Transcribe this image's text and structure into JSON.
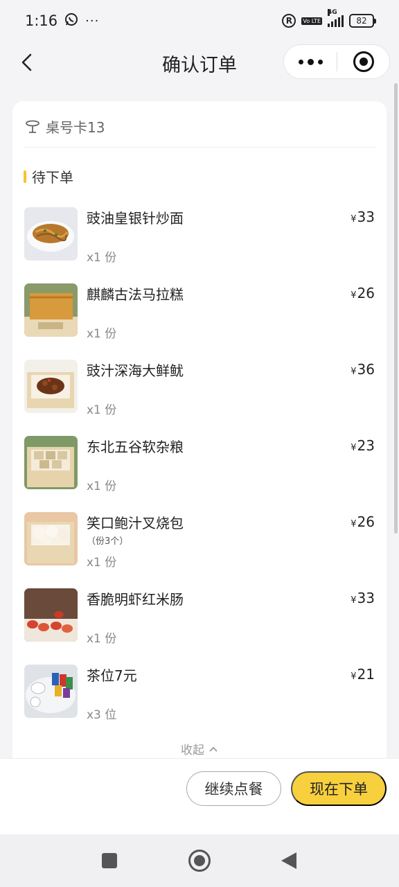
{
  "status": {
    "time": "1:16",
    "network": "4G",
    "volte": "Vo LTE",
    "battery": "82"
  },
  "nav": {
    "title": "确认订单"
  },
  "order": {
    "table_label": "桌号卡13",
    "section_title": "待下单",
    "items": [
      {
        "name": "豉油皇银针炒面",
        "note": "",
        "qty": "x1 份",
        "price": "33"
      },
      {
        "name": "麒麟古法马拉糕",
        "note": "",
        "qty": "x1 份",
        "price": "26"
      },
      {
        "name": "豉汁深海大鲜鱿",
        "note": "",
        "qty": "x1 份",
        "price": "36"
      },
      {
        "name": "东北五谷软杂粮",
        "note": "",
        "qty": "x1 份",
        "price": "23"
      },
      {
        "name": "笑口鲍汁叉烧包",
        "note": "（份3个）",
        "qty": "x1 份",
        "price": "26"
      },
      {
        "name": "香脆明虾红米肠",
        "note": "",
        "qty": "x1 份",
        "price": "33"
      },
      {
        "name": "茶位7元",
        "note": "",
        "qty": "x3 位",
        "price": "21"
      }
    ],
    "currency": "¥",
    "collapse_label": "收起"
  },
  "actions": {
    "continue_label": "继续点餐",
    "order_label": "现在下单"
  },
  "colors": {
    "accent": "#f8cf3d",
    "section_bar": "#f6c431"
  }
}
